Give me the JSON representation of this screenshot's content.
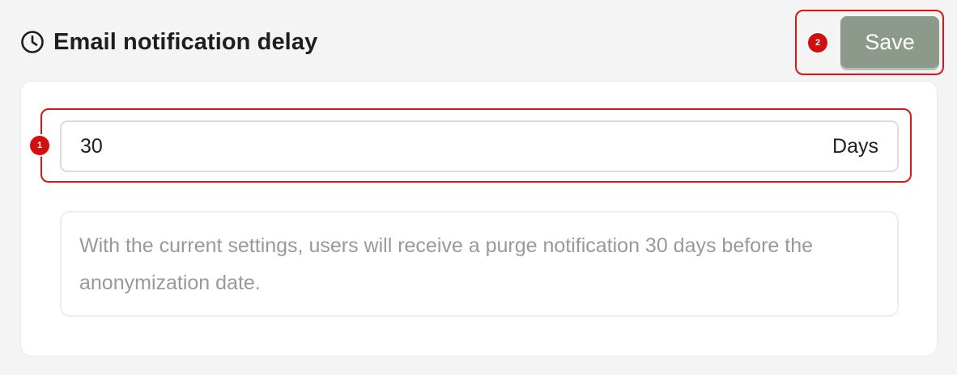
{
  "header": {
    "icon": "clock-icon",
    "title": "Email notification delay"
  },
  "actions": {
    "save_label": "Save",
    "save_color": "#8d9a8b"
  },
  "annotations": {
    "input_badge": "1",
    "save_badge": "2",
    "highlight_color": "#e01414"
  },
  "delay_field": {
    "value": "30",
    "unit": "Days"
  },
  "info": {
    "message": "With the current settings, users will receive a purge notification 30 days before the anonymization date."
  }
}
